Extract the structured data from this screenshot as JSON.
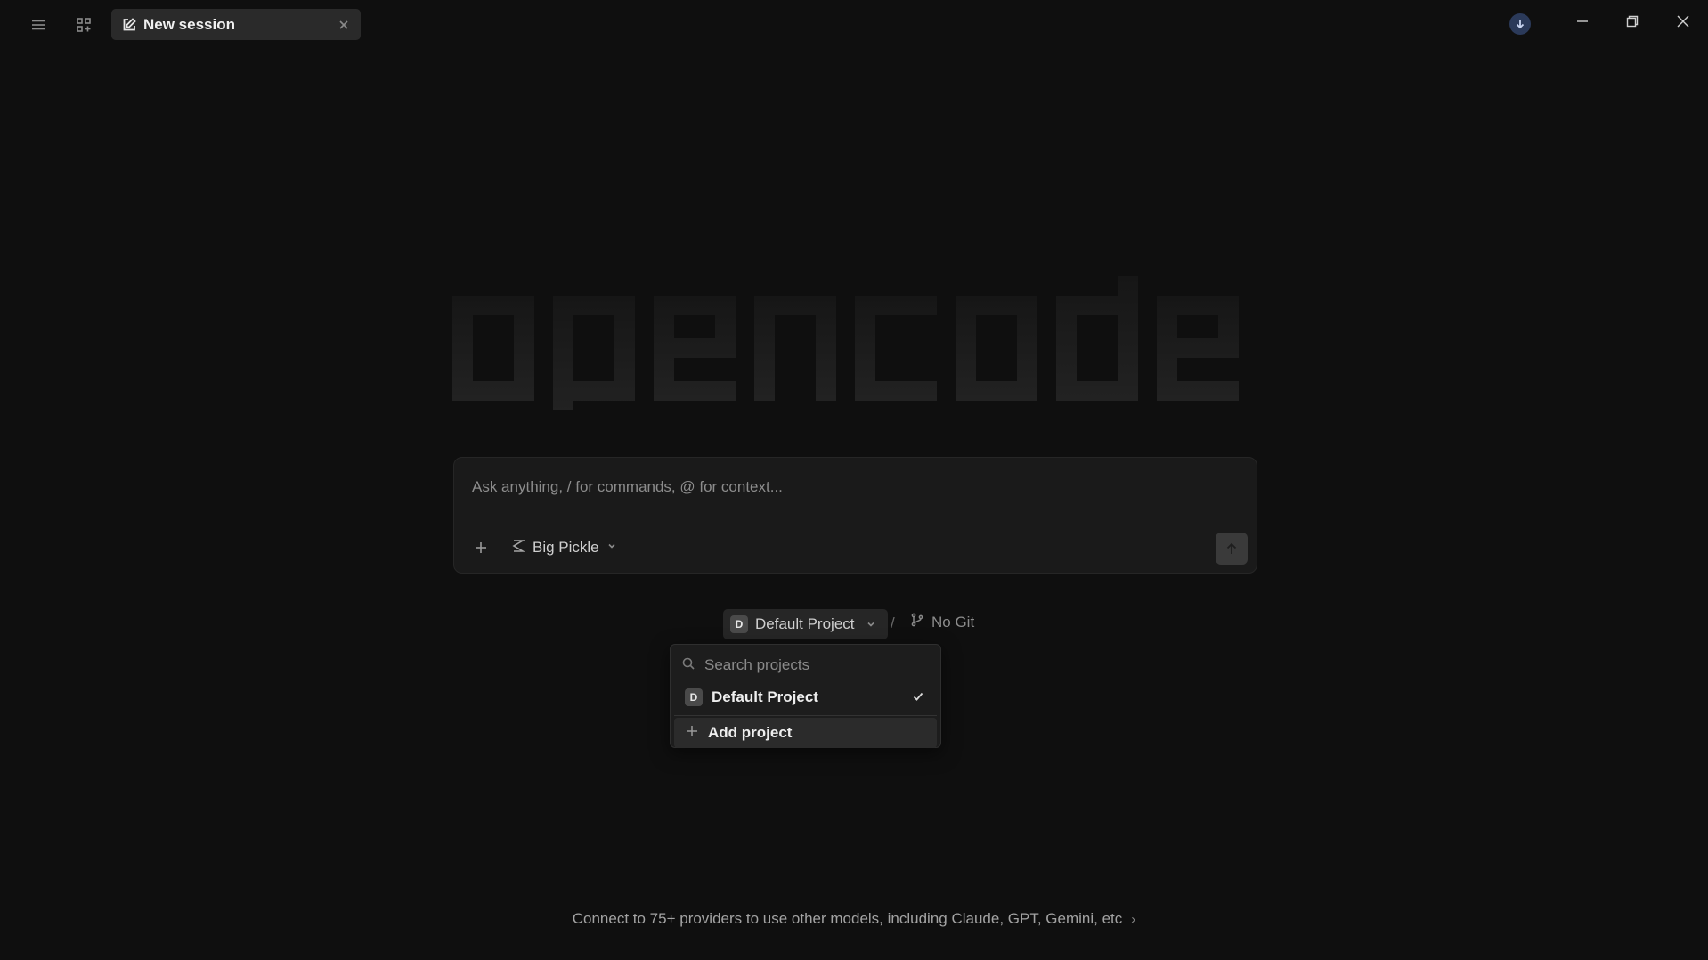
{
  "titlebar": {
    "tab": {
      "label": "New session"
    }
  },
  "logo": {
    "text": "opencode"
  },
  "prompt": {
    "placeholder": "Ask anything, / for commands, @ for context...",
    "model": "Big Pickle"
  },
  "project": {
    "initial": "D",
    "name": "Default Project",
    "separator": "/",
    "git": "No Git"
  },
  "dropdown": {
    "search_placeholder": "Search projects",
    "items": [
      {
        "initial": "D",
        "label": "Default Project",
        "selected": true
      }
    ],
    "add_label": "Add project"
  },
  "footer": {
    "text": "Connect to 75+ providers to use other models, including Claude, GPT, Gemini, etc"
  },
  "colors": {
    "background": "#0f0f0f",
    "panel": "#1a1a1a",
    "update_badge": "#2b3a5a"
  }
}
